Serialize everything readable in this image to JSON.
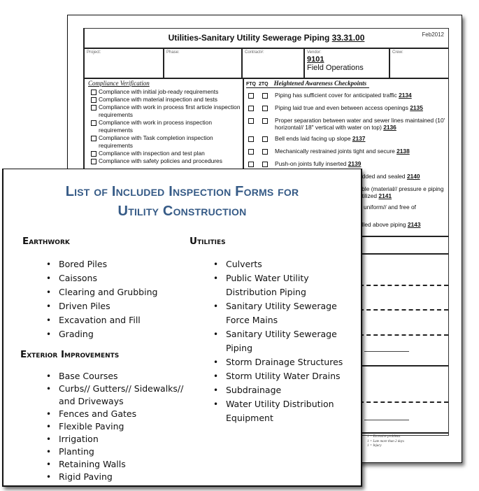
{
  "back_form": {
    "title": "Utilities-Sanitary Utility Sewerage Piping",
    "code": "33.31.00",
    "date": "Feb2012",
    "info": {
      "project_label": "Project:",
      "phase_label": "Phase:",
      "contract_label": "Contract#:",
      "vendor_label": "Vendor:",
      "vendor_number": "9101",
      "vendor_name": "Field Operations",
      "crew_label": "Crew:"
    },
    "compliance": {
      "heading": "Compliance Verification",
      "items": [
        "Compliance with initial job-ready requirements",
        "Compliance with material inspection and tests",
        "Compliance with work in process first article inspection requirements",
        "Compliance with work in process inspection requirements",
        "Compliance with Task completion     inspection requirements",
        "Compliance with inspection and test plan",
        "Compliance with safety policies and procedures"
      ]
    },
    "checkpoints": {
      "col1": "FTQ",
      "col2": "2TQ",
      "heading": "Heightened Awareness Checkpoints",
      "items": [
        {
          "text": "Piping has sufficient cover for anticipated traffic",
          "num": "2134"
        },
        {
          "text": "Piping laid true and even between access openings",
          "num": "2135"
        },
        {
          "text": "Proper separation between water and sewer lines maintained (10' horizontal// 18\" vertical with water on top)",
          "num": "2136"
        },
        {
          "text": "Bell ends laid facing up slope",
          "num": "2137"
        },
        {
          "text": "Mechanically restrained joints tight and secure",
          "num": "2138"
        },
        {
          "text": "Push-on joints fully inserted",
          "num": "2139"
        },
        {
          "text": "edded and sealed",
          "num": "2140"
        },
        {
          "text": "tible (material// pressure e piping utilized",
          "num": "2141"
        },
        {
          "text": "// uniform// and free of",
          "num": ""
        },
        {
          "text": "alled above piping",
          "num": "2143"
        }
      ]
    },
    "legend": [
      "1 = Excessive problems",
      "1 = Late more than 2 days",
      "1 = Injury"
    ]
  },
  "front_page": {
    "title_line1": "List of Included Inspection Forms for",
    "title_line2": "Utility Construction",
    "sections": {
      "earthwork": {
        "heading": "Earthwork",
        "items": [
          "Bored Piles",
          "Caissons",
          "Clearing and Grubbing",
          "Driven Piles",
          "Excavation and Fill",
          "Grading"
        ]
      },
      "exterior": {
        "heading": "Exterior Improvements",
        "items": [
          "Base Courses",
          "Curbs// Gutters// Sidewalks// and Driveways",
          "Fences and Gates",
          "Flexible Paving",
          "Irrigation",
          "Planting",
          "Retaining Walls",
          "Rigid Paving"
        ]
      },
      "utilities": {
        "heading": "Utilities",
        "items": [
          "Culverts",
          "Public Water Utility Distribution Piping",
          "Sanitary Utility Sewerage Force Mains",
          "Sanitary Utility Sewerage Piping",
          "Storm Drainage Structures",
          "Storm Utility Water Drains",
          "Subdrainage",
          "Water Utility Distribution Equipment"
        ]
      }
    },
    "bullet": "•",
    "title_color": "#355a86"
  }
}
